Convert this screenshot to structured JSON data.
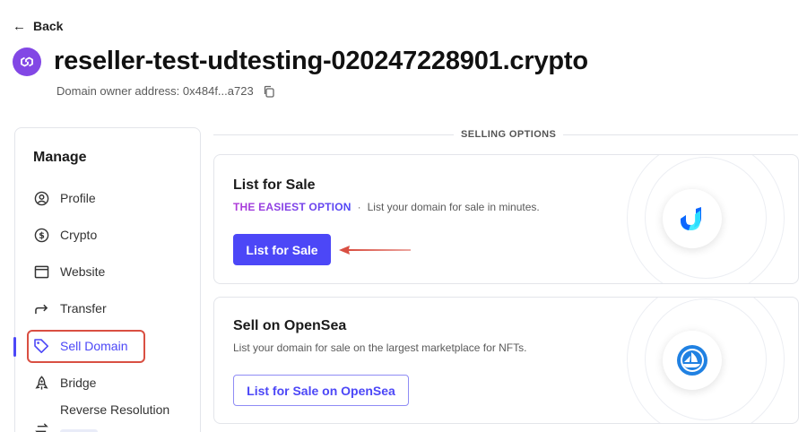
{
  "nav_back": {
    "label": "Back",
    "icon": "arrow-left-icon"
  },
  "header": {
    "title": "reseller-test-udtesting-020247228901.crypto",
    "owner_label": "Domain owner address: 0x484f...a723",
    "badge_color": "#8247e5"
  },
  "sidebar": {
    "heading": "Manage",
    "items": [
      {
        "label": "Profile",
        "icon": "user-circle-icon",
        "active": false
      },
      {
        "label": "Crypto",
        "icon": "dollar-circle-icon",
        "active": false
      },
      {
        "label": "Website",
        "icon": "browser-window-icon",
        "active": false
      },
      {
        "label": "Transfer",
        "icon": "arrow-share-icon",
        "active": false
      },
      {
        "label": "Sell Domain",
        "icon": "tag-icon",
        "active": true
      },
      {
        "label": "Bridge",
        "icon": "rocket-icon",
        "active": false
      },
      {
        "label": "Reverse Resolution",
        "icon": "swap-arrows-icon",
        "active": false
      }
    ]
  },
  "selling": {
    "section_label": "SELLING OPTIONS",
    "list_for_sale": {
      "title": "List for Sale",
      "tag": "THE EASIEST OPTION",
      "separator": "·",
      "description": "List your domain for sale in minutes.",
      "button": "List for Sale",
      "logo": "unstoppable-domains-logo-icon"
    },
    "opensea": {
      "title": "Sell on OpenSea",
      "description": "List your domain for sale on the largest marketplace for NFTs.",
      "button": "List for Sale on OpenSea",
      "logo": "opensea-logo-icon"
    }
  },
  "colors": {
    "accent": "#4c47f7",
    "annotation_red": "#d94f42"
  }
}
